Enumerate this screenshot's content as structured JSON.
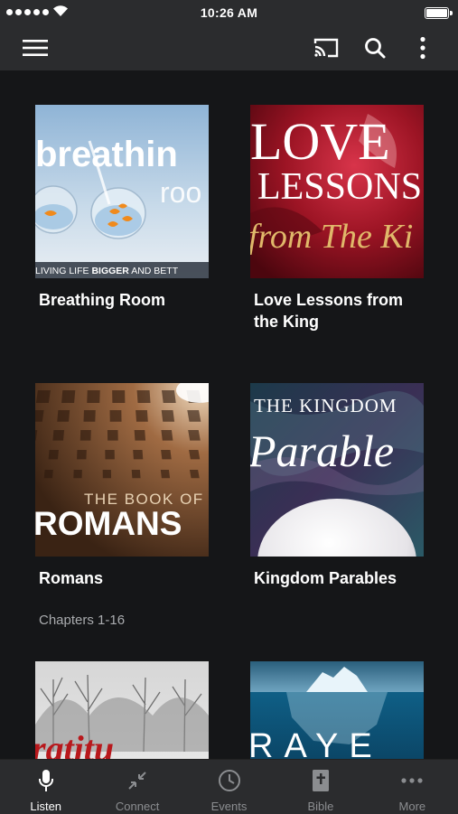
{
  "status_bar": {
    "time": "10:26 AM",
    "battery_level": 1.0
  },
  "app_bar": {
    "icons": [
      "menu-icon",
      "cast-icon",
      "search-icon",
      "more-vert-icon"
    ]
  },
  "cards": [
    {
      "title": "Breathing Room",
      "subtitle": "",
      "art_text": {
        "main": "breathin",
        "sub": "roo",
        "tagline_a": "LIVING LIFE ",
        "tagline_b": "BIGGER",
        "tagline_c": " AND BETT"
      }
    },
    {
      "title": "Love Lessons from the King",
      "subtitle": "",
      "art_text": {
        "line1": "LOVE",
        "line2": "LESSONS",
        "line3": "from The Ki"
      }
    },
    {
      "title": "Romans",
      "subtitle": "Chapters 1-16",
      "art_text": {
        "line1": "THE BOOK OF",
        "line2": "ROMANS"
      }
    },
    {
      "title": "Kingdom Parables",
      "subtitle": "",
      "art_text": {
        "line1": "THE KINGDOM",
        "line2": "Parable"
      }
    },
    {
      "title": "",
      "subtitle": "",
      "art_text": {
        "line1": "ratitu"
      }
    },
    {
      "title": "",
      "subtitle": "",
      "art_text": {
        "line1": "RAYE"
      }
    }
  ],
  "tabs": [
    {
      "label": "Listen",
      "icon": "microphone-icon",
      "active": true
    },
    {
      "label": "Connect",
      "icon": "connect-arrows-icon",
      "active": false
    },
    {
      "label": "Events",
      "icon": "clock-icon",
      "active": false
    },
    {
      "label": "Bible",
      "icon": "bible-icon",
      "active": false
    },
    {
      "label": "More",
      "icon": "more-horiz-icon",
      "active": false
    }
  ]
}
